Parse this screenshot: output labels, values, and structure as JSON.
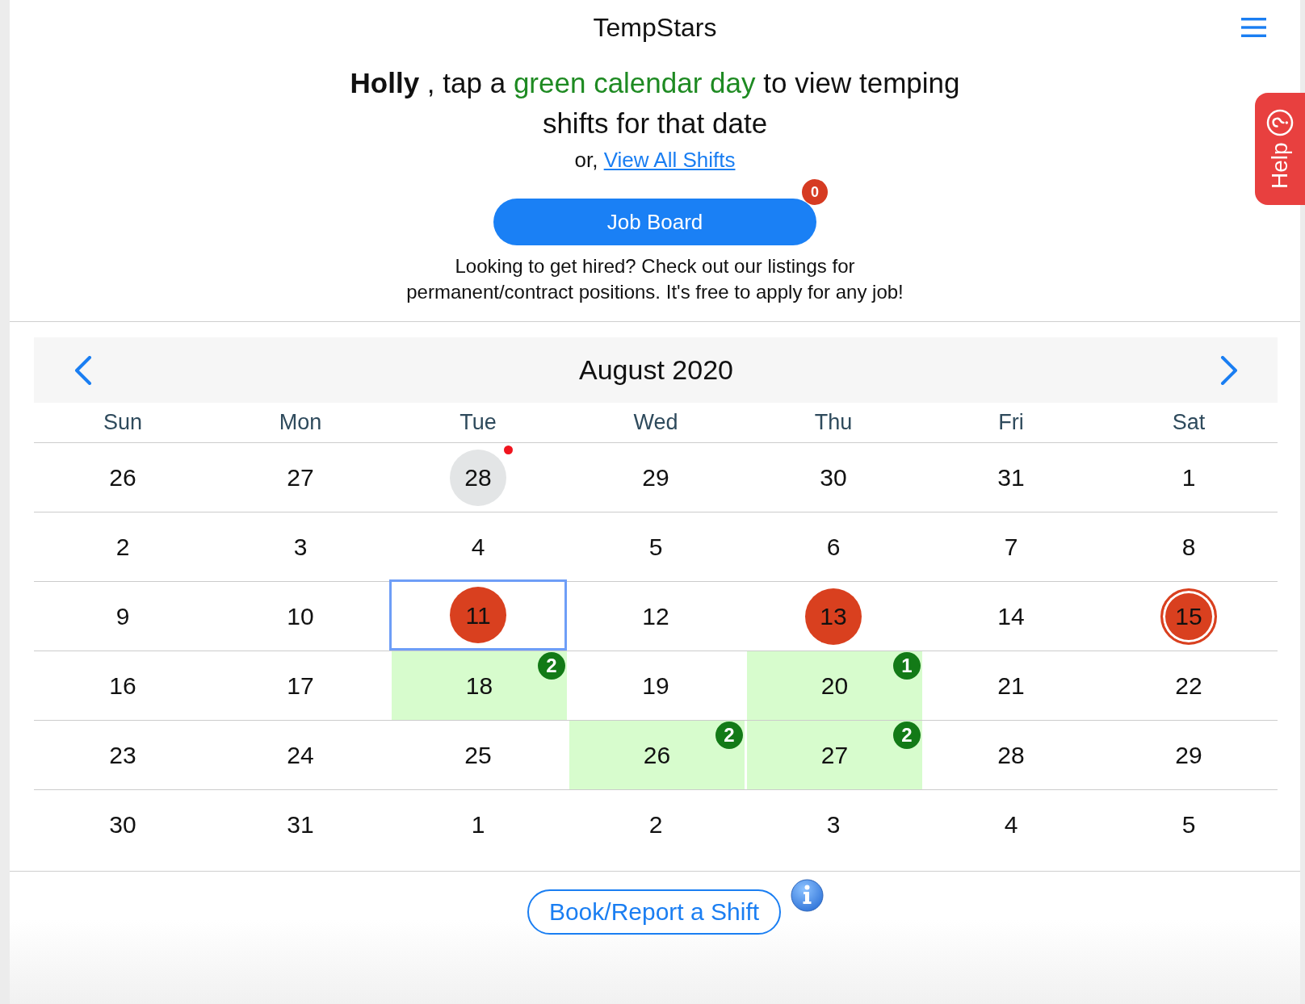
{
  "header": {
    "title": "TempStars"
  },
  "intro": {
    "heading_parts": [
      {
        "kind": "name",
        "text": "Holly"
      },
      {
        "kind": "plain",
        "text": ", tap a"
      },
      {
        "kind": "highlight",
        "text": "green calendar day"
      },
      {
        "kind": "plain",
        "text": "to view temping shifts for that date"
      }
    ],
    "link_prefix": "or,",
    "link": "View All Shifts"
  },
  "job_board": {
    "label": "Job Board",
    "badge": "0",
    "note": "Looking to get hired? Check out our listings for permanent/contract positions. It's free to apply for any job!"
  },
  "help_tab": {
    "label": "Help"
  },
  "calendar": {
    "month": "August 2020",
    "weekdays": [
      "Sun",
      "Mon",
      "Tue",
      "Wed",
      "Thu",
      "Fri",
      "Sat"
    ],
    "weeks": [
      {
        "days": [
          {
            "day": "26",
            "kind": "plain",
            "selected": false,
            "available": false
          },
          {
            "day": "27",
            "kind": "plain",
            "selected": false,
            "available": false
          },
          {
            "day": "28",
            "kind": "today",
            "selected": false,
            "available": false
          },
          {
            "day": "29",
            "kind": "plain",
            "selected": false,
            "available": false
          },
          {
            "day": "30",
            "kind": "plain",
            "selected": false,
            "available": false
          },
          {
            "day": "31",
            "kind": "plain",
            "selected": false,
            "available": false
          },
          {
            "day": "1",
            "kind": "plain",
            "selected": false,
            "available": false
          }
        ]
      },
      {
        "days": [
          {
            "day": "2",
            "kind": "plain",
            "selected": false,
            "available": false
          },
          {
            "day": "3",
            "kind": "plain",
            "selected": false,
            "available": false
          },
          {
            "day": "4",
            "kind": "plain",
            "selected": false,
            "available": false
          },
          {
            "day": "5",
            "kind": "plain",
            "selected": false,
            "available": false
          },
          {
            "day": "6",
            "kind": "plain",
            "selected": false,
            "available": false
          },
          {
            "day": "7",
            "kind": "plain",
            "selected": false,
            "available": false
          },
          {
            "day": "8",
            "kind": "plain",
            "selected": false,
            "available": false
          }
        ]
      },
      {
        "days": [
          {
            "day": "9",
            "kind": "plain",
            "selected": false,
            "available": false
          },
          {
            "day": "10",
            "kind": "plain",
            "selected": false,
            "available": false
          },
          {
            "day": "11",
            "kind": "booked",
            "selected": true,
            "available": false
          },
          {
            "day": "12",
            "kind": "plain",
            "selected": false,
            "available": false
          },
          {
            "day": "13",
            "kind": "booked",
            "selected": false,
            "available": false
          },
          {
            "day": "14",
            "kind": "plain",
            "selected": false,
            "available": false
          },
          {
            "day": "15",
            "kind": "booked_ring",
            "selected": false,
            "available": false
          }
        ]
      },
      {
        "days": [
          {
            "day": "16",
            "kind": "plain",
            "selected": false,
            "available": false
          },
          {
            "day": "17",
            "kind": "plain",
            "selected": false,
            "available": false
          },
          {
            "day": "18",
            "kind": "plain",
            "selected": false,
            "available": true,
            "shift_count": "2"
          },
          {
            "day": "19",
            "kind": "plain",
            "selected": false,
            "available": false
          },
          {
            "day": "20",
            "kind": "plain",
            "selected": false,
            "available": true,
            "shift_count": "1"
          },
          {
            "day": "21",
            "kind": "plain",
            "selected": false,
            "available": false
          },
          {
            "day": "22",
            "kind": "plain",
            "selected": false,
            "available": false
          }
        ]
      },
      {
        "days": [
          {
            "day": "23",
            "kind": "plain",
            "selected": false,
            "available": false
          },
          {
            "day": "24",
            "kind": "plain",
            "selected": false,
            "available": false
          },
          {
            "day": "25",
            "kind": "plain",
            "selected": false,
            "available": false
          },
          {
            "day": "26",
            "kind": "plain",
            "selected": false,
            "available": true,
            "shift_count": "2"
          },
          {
            "day": "27",
            "kind": "plain",
            "selected": false,
            "available": true,
            "shift_count": "2"
          },
          {
            "day": "28",
            "kind": "plain",
            "selected": false,
            "available": false
          },
          {
            "day": "29",
            "kind": "plain",
            "selected": false,
            "available": false
          }
        ]
      },
      {
        "days": [
          {
            "day": "30",
            "kind": "plain",
            "selected": false,
            "available": false
          },
          {
            "day": "31",
            "kind": "plain",
            "selected": false,
            "available": false
          },
          {
            "day": "1",
            "kind": "plain",
            "selected": false,
            "available": false
          },
          {
            "day": "2",
            "kind": "plain",
            "selected": false,
            "available": false
          },
          {
            "day": "3",
            "kind": "plain",
            "selected": false,
            "available": false
          },
          {
            "day": "4",
            "kind": "plain",
            "selected": false,
            "available": false
          },
          {
            "day": "5",
            "kind": "plain",
            "selected": false,
            "available": false
          }
        ]
      }
    ]
  },
  "footer": {
    "button": "Book/Report a Shift"
  }
}
